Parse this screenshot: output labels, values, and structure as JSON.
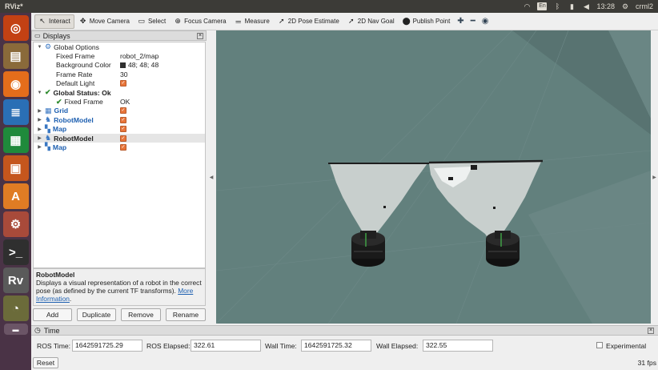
{
  "window": {
    "title": "RViz*"
  },
  "system_tray": {
    "kbd": "En",
    "time": "13:28",
    "user": "crml2"
  },
  "launcher": {
    "apps": [
      {
        "icon": "ubuntu-icon",
        "color": "#c34113",
        "glyph": "◎"
      },
      {
        "icon": "files-icon",
        "color": "#8a6a3a",
        "glyph": "▤"
      },
      {
        "icon": "firefox-icon",
        "color": "#e46d1b",
        "glyph": "◉"
      },
      {
        "icon": "writer-icon",
        "color": "#2a6fb5",
        "glyph": "≣"
      },
      {
        "icon": "calc-icon",
        "color": "#1f8a3b",
        "glyph": "▦"
      },
      {
        "icon": "impress-icon",
        "color": "#c5561d",
        "glyph": "▣"
      },
      {
        "icon": "software-icon",
        "color": "#e07c24",
        "glyph": "A"
      },
      {
        "icon": "settings-icon",
        "color": "#a84a3a",
        "glyph": "⚙"
      },
      {
        "icon": "terminal-icon",
        "color": "#2f2f2f",
        "glyph": ">_"
      },
      {
        "icon": "rviz-icon",
        "color": "#5a5a5a",
        "glyph": "Rv"
      },
      {
        "icon": "screenshot-icon",
        "color": "#6b6b3a",
        "glyph": "◔"
      }
    ]
  },
  "toolbar": {
    "tools": [
      {
        "label": "Interact",
        "icon": "interact-icon",
        "glyph": "↖",
        "active": true
      },
      {
        "label": "Move Camera",
        "icon": "move-camera-icon",
        "glyph": "✥"
      },
      {
        "label": "Select",
        "icon": "select-icon",
        "glyph": "▭"
      },
      {
        "label": "Focus Camera",
        "icon": "focus-camera-icon",
        "glyph": "⊕"
      },
      {
        "label": "Measure",
        "icon": "measure-icon",
        "glyph": "═"
      },
      {
        "label": "2D Pose Estimate",
        "icon": "pose-estimate-icon",
        "glyph": "➚"
      },
      {
        "label": "2D Nav Goal",
        "icon": "nav-goal-icon",
        "glyph": "➚"
      },
      {
        "label": "Publish Point",
        "icon": "publish-point-icon",
        "glyph": "⬤"
      }
    ]
  },
  "displays": {
    "title": "Displays",
    "rows": [
      {
        "indent": 0,
        "expand": "▼",
        "icon": "gear",
        "name": "Global Options",
        "style": "",
        "value": ""
      },
      {
        "indent": 1,
        "name": "Fixed Frame",
        "value": "robot_2/map"
      },
      {
        "indent": 1,
        "name": "Background Color",
        "value": "48; 48; 48",
        "swatch": true
      },
      {
        "indent": 1,
        "name": "Frame Rate",
        "value": "30"
      },
      {
        "indent": 1,
        "name": "Default Light",
        "check": true
      },
      {
        "indent": 0,
        "expand": "▼",
        "icon": "tick",
        "name": "Global Status: Ok",
        "style": "bold",
        "value": ""
      },
      {
        "indent": 1,
        "icon": "tick",
        "name": "Fixed Frame",
        "value": "OK"
      },
      {
        "indent": 0,
        "expand": "▶",
        "icon": "grid",
        "name": "Grid",
        "style": "blue",
        "check": true
      },
      {
        "indent": 0,
        "expand": "▶",
        "icon": "robot",
        "name": "RobotModel",
        "style": "blue",
        "check": true
      },
      {
        "indent": 0,
        "expand": "▶",
        "icon": "map",
        "name": "Map",
        "style": "blue",
        "check": true
      },
      {
        "indent": 0,
        "expand": "▶",
        "icon": "robot",
        "name": "RobotModel",
        "style": "bold",
        "check": true,
        "selected": true
      },
      {
        "indent": 0,
        "expand": "▶",
        "icon": "map",
        "name": "Map",
        "style": "blue",
        "check": true
      }
    ],
    "description": {
      "title": "RobotModel",
      "text": "Displays a visual representation of a robot in the correct pose (as defined by the current TF transforms).",
      "link": "More Information",
      "after": "."
    },
    "buttons": {
      "add": "Add",
      "duplicate": "Duplicate",
      "remove": "Remove",
      "rename": "Rename"
    }
  },
  "time": {
    "title": "Time",
    "ros_time_label": "ROS Time:",
    "ros_time": "1642591725.29",
    "ros_elapsed_label": "ROS Elapsed:",
    "ros_elapsed": "322.61",
    "wall_time_label": "Wall Time:",
    "wall_time": "1642591725.32",
    "wall_elapsed_label": "Wall Elapsed:",
    "wall_elapsed": "322.55",
    "experimental_label": "Experimental",
    "reset_label": "Reset",
    "fps": "31 fps"
  },
  "colors": {
    "view_bg": "#5c7775",
    "grid_floor": "#6a8482",
    "scan_free": "#c8cfcd",
    "scan_occupied": "#1e1e1e"
  }
}
